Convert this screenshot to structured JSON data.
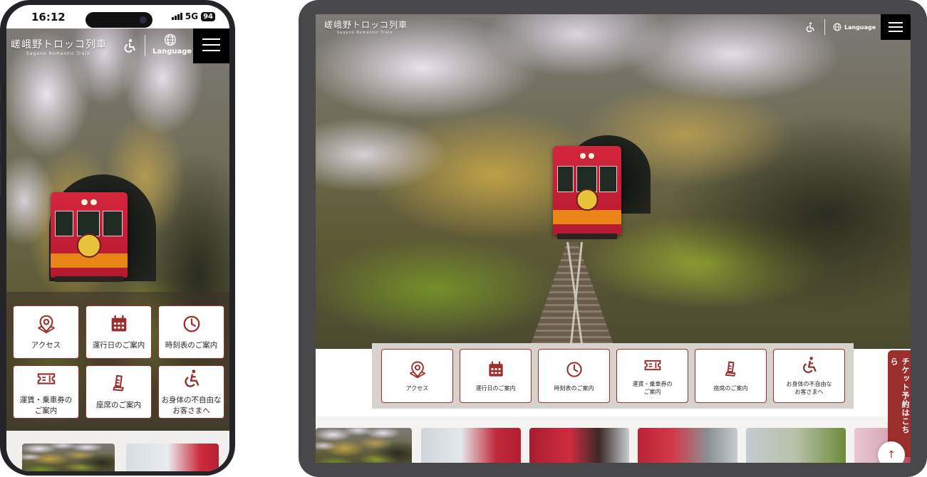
{
  "phone": {
    "status": {
      "time": "16:12",
      "network": "5G",
      "battery": "94"
    },
    "header": {
      "logo_main": "嵯峨野トロッコ列車",
      "logo_sub": "Sagano Romantic Train",
      "language_label": "Language"
    },
    "quick_menu": [
      {
        "icon": "map-pin-icon",
        "label": "アクセス"
      },
      {
        "icon": "calendar-icon",
        "label": "運行日のご案内"
      },
      {
        "icon": "clock-icon",
        "label": "時刻表のご案内"
      },
      {
        "icon": "ticket-icon",
        "label": "運賃・乗車券の\nご案内"
      },
      {
        "icon": "seat-icon",
        "label": "座席のご案内"
      },
      {
        "icon": "wheelchair-icon",
        "label": "お身体の不自由な\nお客さまへ"
      }
    ]
  },
  "tablet": {
    "header": {
      "logo_main": "嵯峨野トロッコ列車",
      "logo_sub": "Sagano Romantic Train",
      "language_label": "Language"
    },
    "quick_menu": [
      {
        "icon": "map-pin-icon",
        "label": "アクセス"
      },
      {
        "icon": "calendar-icon",
        "label": "運行日のご案内"
      },
      {
        "icon": "clock-icon",
        "label": "時刻表のご案内"
      },
      {
        "icon": "ticket-icon",
        "label": "運賃・乗車券の\nご案内"
      },
      {
        "icon": "seat-icon",
        "label": "座席のご案内"
      },
      {
        "icon": "wheelchair-icon",
        "label": "お身体の不自由な\nお客さまへ"
      }
    ],
    "ticket_tab_label": "チケット予約はこちら"
  },
  "colors": {
    "accent": "#9b2f2b",
    "tray": "#d8d2cc",
    "header_black": "#000000"
  }
}
